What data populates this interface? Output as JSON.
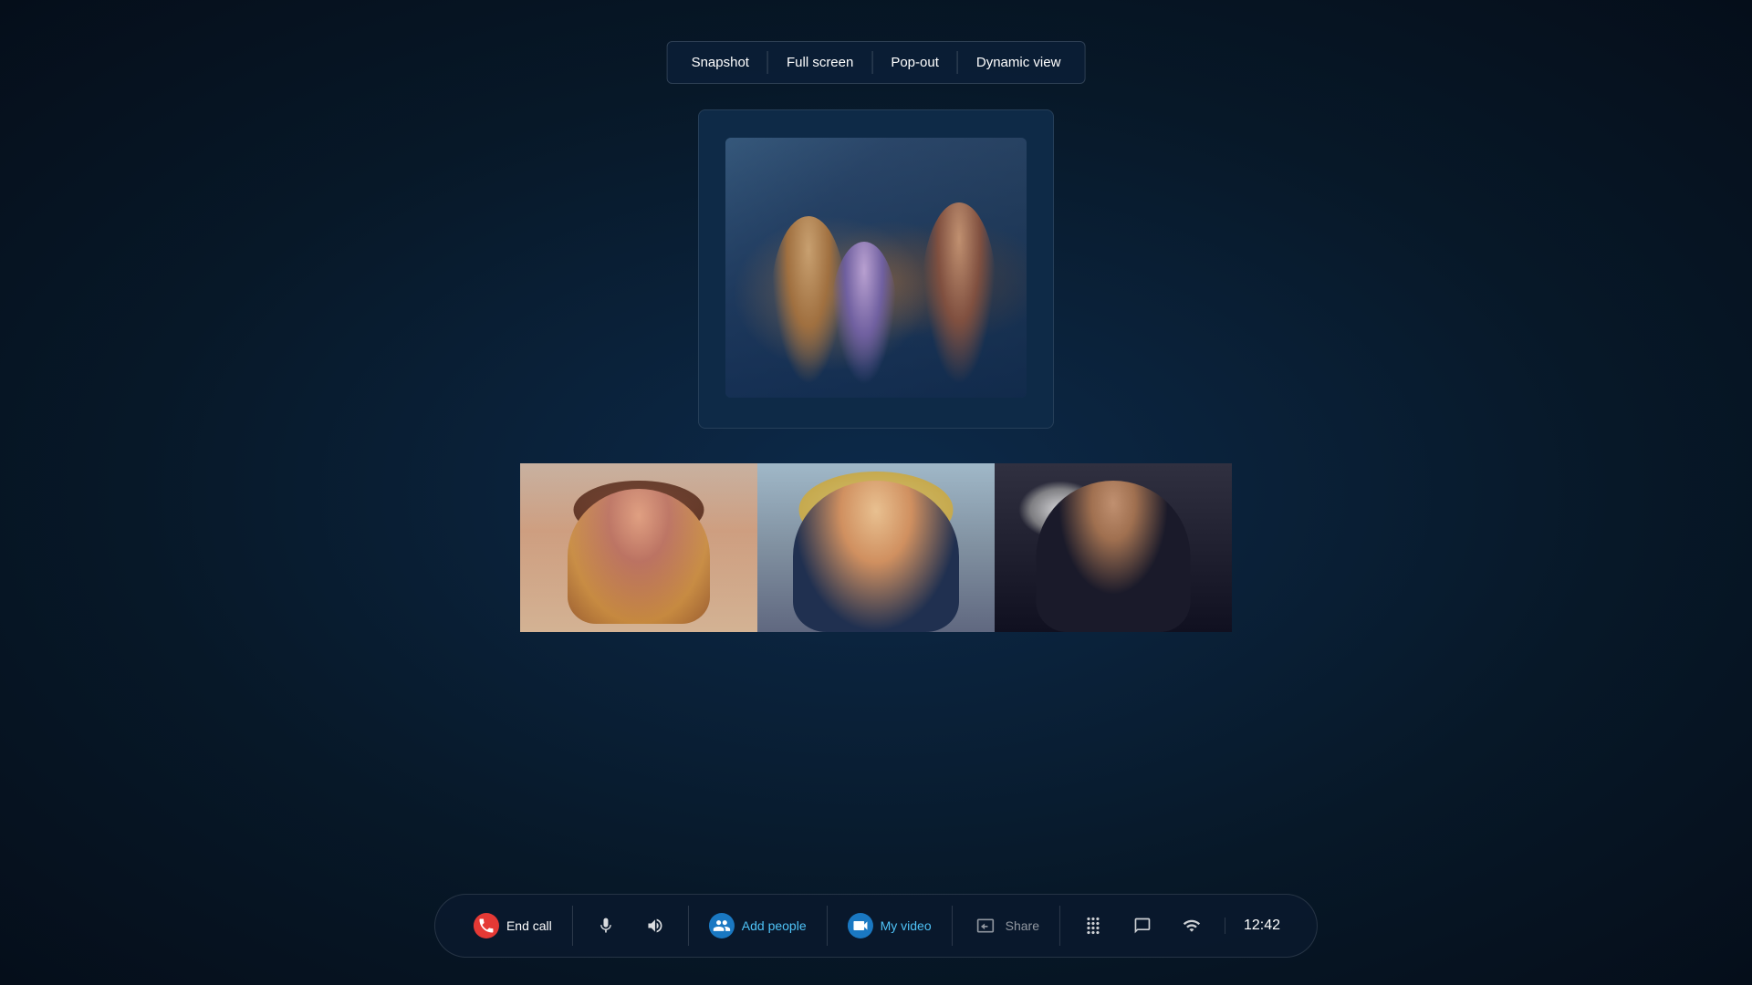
{
  "toolbar": {
    "buttons": [
      {
        "id": "snapshot",
        "label": "Snapshot"
      },
      {
        "id": "fullscreen",
        "label": "Full screen"
      },
      {
        "id": "popout",
        "label": "Pop-out"
      },
      {
        "id": "dynamicview",
        "label": "Dynamic view"
      }
    ]
  },
  "bottombar": {
    "end_call_label": "End call",
    "mute_label": "",
    "speaker_label": "",
    "add_people_label": "Add people",
    "my_video_label": "My video",
    "share_label": "Share",
    "time": "12:42"
  }
}
